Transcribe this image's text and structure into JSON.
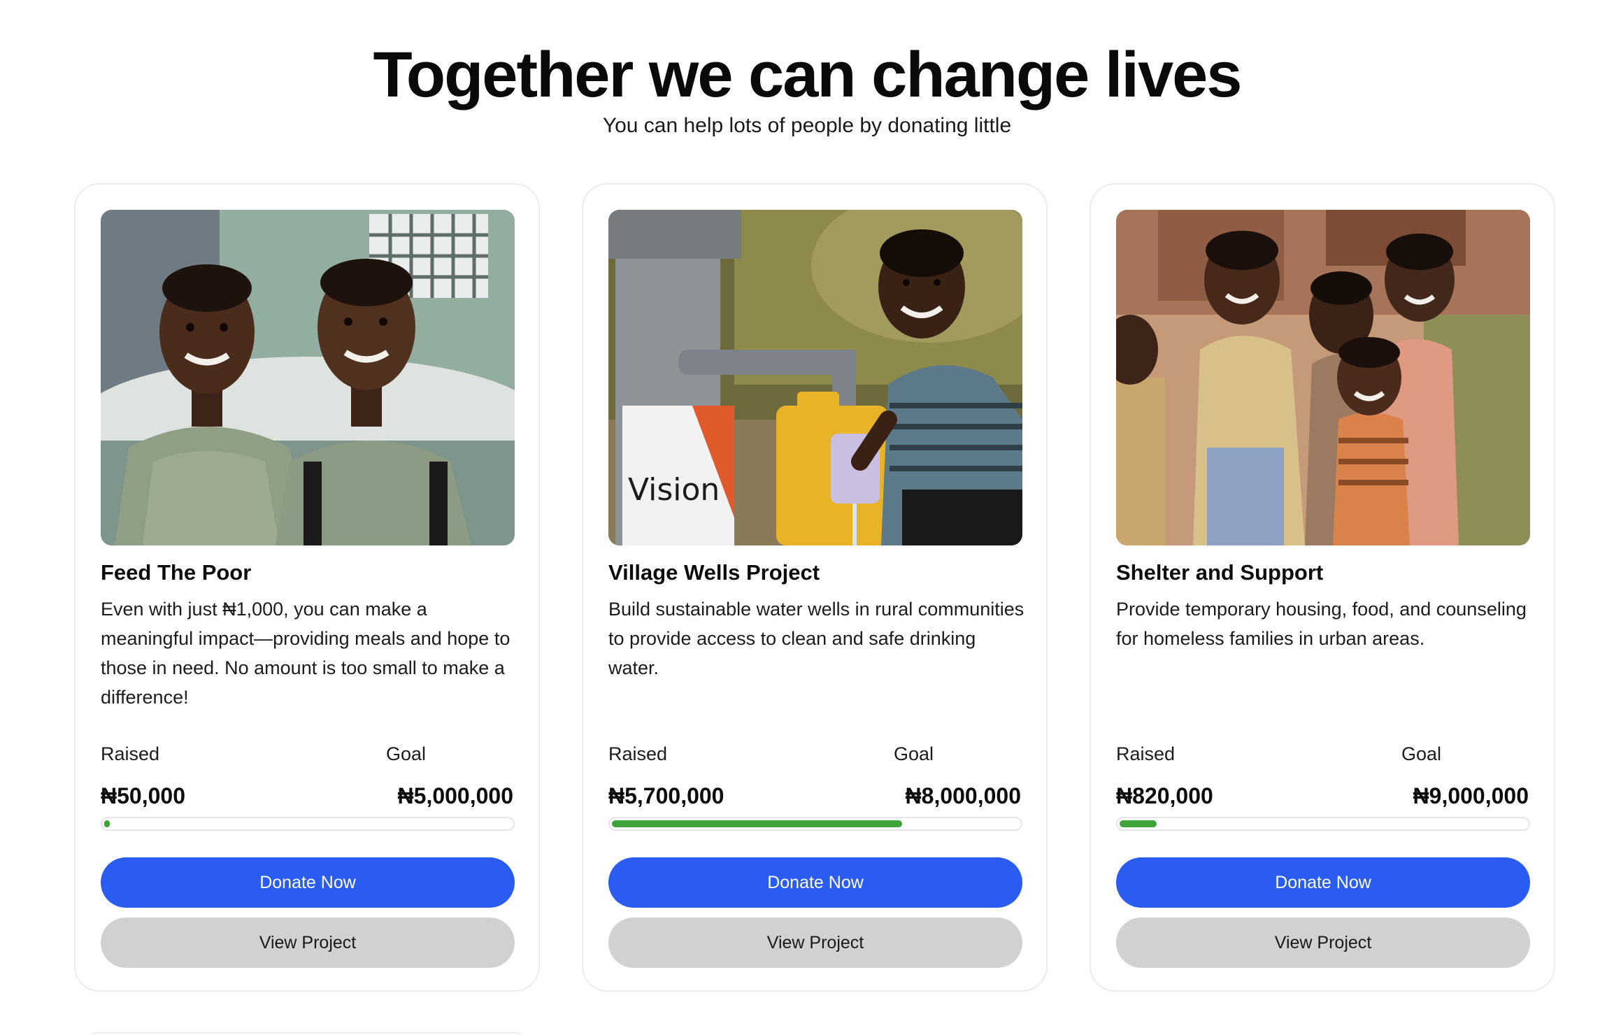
{
  "hero": {
    "title": "Together we can change lives",
    "subtitle": "You can help lots of people by donating little"
  },
  "colors": {
    "primary_button": "#2a5cf2",
    "secondary_button": "#d1d1d1",
    "progress_fill": "#3ea33b",
    "card_border": "#ececec"
  },
  "cards": [
    {
      "image_alt": "two smiling boys in checked school shirts",
      "title": "Feed The Poor",
      "description": "Even with just ₦1,000, you can make a meaningful impact—providing meals and hope to those in need. No amount is too small to make a difference!",
      "raised_label": "Raised",
      "raised_value": "₦50,000",
      "goal_label": "Goal",
      "goal_value": "₦5,000,000",
      "progress_fraction": 0.01,
      "donate_label": "Donate Now",
      "view_label": "View Project"
    },
    {
      "image_alt": "child filling a cup at a village water pump",
      "image_text": "Vision",
      "title": "Village Wells Project",
      "description": "Build sustainable water wells in rural communities to provide access to clean and safe drinking water.",
      "raised_label": "Raised",
      "raised_value": "₦5,700,000",
      "goal_label": "Goal",
      "goal_value": "₦8,000,000",
      "progress_fraction": 0.7125,
      "donate_label": "Donate Now",
      "view_label": "View Project"
    },
    {
      "image_alt": "group of smiling children outdoors",
      "title": "Shelter and Support",
      "description": "Provide temporary housing, food, and counseling for homeless families in urban areas.",
      "raised_label": "Raised",
      "raised_value": "₦820,000",
      "goal_label": "Goal",
      "goal_value": "₦9,000,000",
      "progress_fraction": 0.0911,
      "donate_label": "Donate Now",
      "view_label": "View Project"
    }
  ]
}
